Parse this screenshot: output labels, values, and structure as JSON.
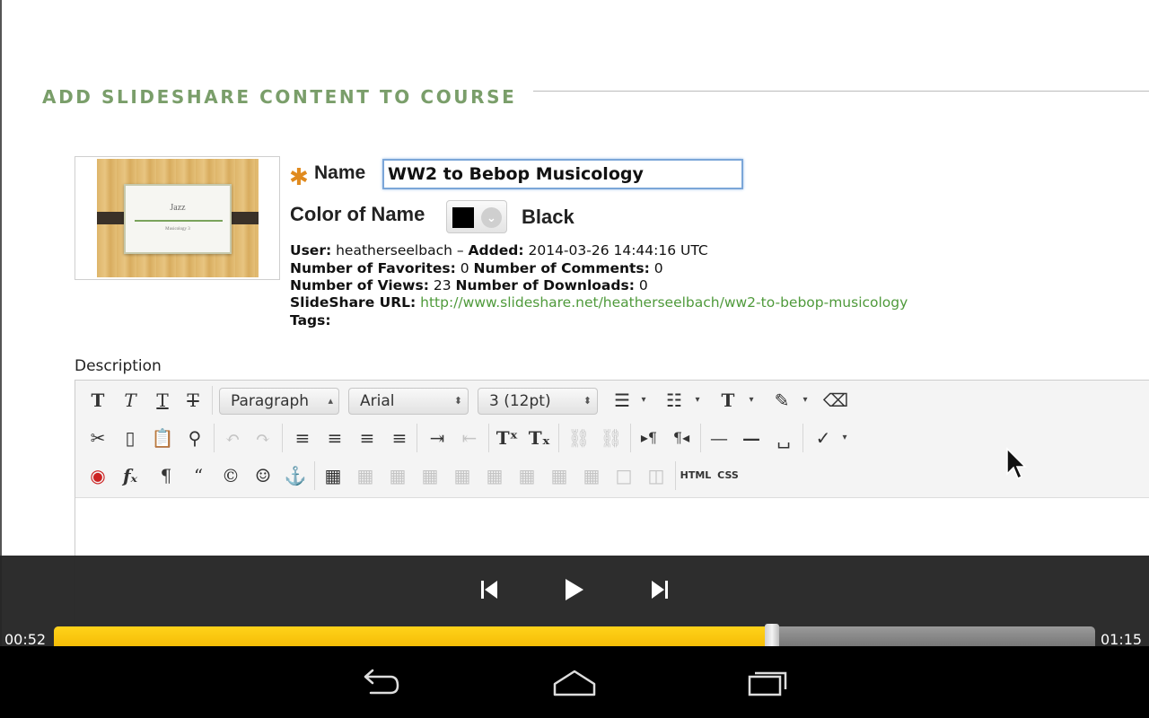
{
  "section": {
    "title": "ADD SLIDESHARE CONTENT TO COURSE"
  },
  "thumbnail": {
    "title": "Jazz",
    "subtitle": "Musicology 3"
  },
  "form": {
    "name_label": "Name",
    "name_value": "WW2 to Bebop Musicology",
    "color_label": "Color of Name",
    "color_value": "Black",
    "color_swatch": "#000000"
  },
  "meta": {
    "user_label": "User:",
    "user_value": "heatherseelbach",
    "added_label": "Added:",
    "added_value": "2014-03-26 14:44:16 UTC",
    "favorites_label": "Number of Favorites:",
    "favorites_value": "0",
    "comments_label": "Number of Comments:",
    "comments_value": "0",
    "views_label": "Number of Views:",
    "views_value": "23",
    "downloads_label": "Number of Downloads:",
    "downloads_value": "0",
    "url_label": "SlideShare URL:",
    "url_value": "http://www.slideshare.net/heatherseelbach/ww2-to-bebop-musicology",
    "tags_label": "Tags:"
  },
  "editor": {
    "description_label": "Description",
    "paragraph_select": "Paragraph",
    "font_select": "Arial",
    "size_select": "3 (12pt)",
    "html_button": "HTML",
    "css_button": "CSS"
  },
  "player": {
    "elapsed": "00:52",
    "total": "01:15",
    "progress": 0.69
  },
  "colors": {
    "accent_green": "#7a9e6a",
    "link_green": "#4f9a3b",
    "required_orange": "#e08a1e",
    "seek_fill": "#f2b600"
  }
}
